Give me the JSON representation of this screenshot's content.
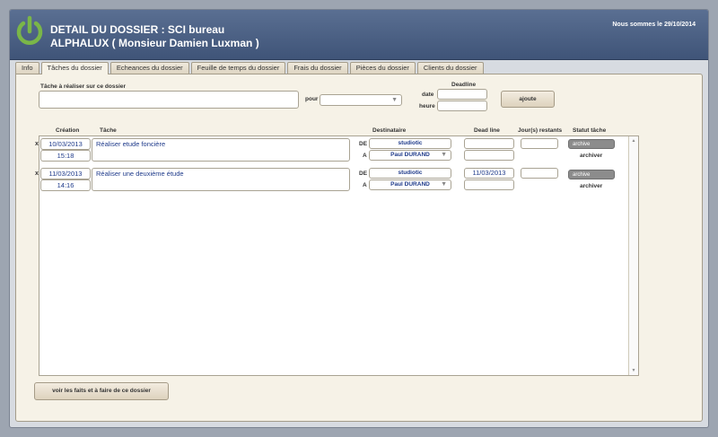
{
  "header": {
    "title_line1": "DETAIL DU DOSSIER : SCI bureau",
    "title_line2": "ALPHALUX ( Monsieur Damien Luxman )",
    "date_text": "Nous sommes le 29/10/2014"
  },
  "tabs": [
    {
      "label": "Info",
      "active": false
    },
    {
      "label": "Tâches du dossier",
      "active": true
    },
    {
      "label": "Echeances du dossier",
      "active": false
    },
    {
      "label": "Feuille de temps du dossier",
      "active": false
    },
    {
      "label": "Frais du dossier",
      "active": false
    },
    {
      "label": "Pièces du dossier",
      "active": false
    },
    {
      "label": "Clients du dossier",
      "active": false
    }
  ],
  "form": {
    "task_label": "Tâche à réaliser sur ce dossier",
    "task_value": "",
    "pour_label": "pour",
    "pour_value": "",
    "deadline_label": "Deadline",
    "date_label": "date",
    "date_value": "",
    "heure_label": "heure",
    "heure_value": "",
    "add_button": "ajoute"
  },
  "columns": {
    "creation": "Création",
    "tache": "Tâche",
    "destinataire": "Destinataire",
    "deadline": "Dead line",
    "jours": "Jour(s) restants",
    "statut": "Statut tâche"
  },
  "tasks": [
    {
      "delete": "x",
      "date": "10/03/2013",
      "time": "15:18",
      "description": "Réaliser etude foncière",
      "de_label": "DE",
      "de_value": "studiotic",
      "a_label": "A",
      "a_value": "Paul DURAND",
      "deadline": "",
      "deadline2": "",
      "jours": "",
      "status_badge": "archive",
      "status_action": "archiver"
    },
    {
      "delete": "x",
      "date": "11/03/2013",
      "time": "14:16",
      "description": "Réaliser une deuxième étude",
      "de_label": "DE",
      "de_value": "studiotic",
      "a_label": "A",
      "a_value": "Paul DURAND",
      "deadline": "11/03/2013",
      "deadline2": "",
      "jours": "",
      "status_badge": "archive",
      "status_action": "archiver"
    }
  ],
  "footer": {
    "button": "voir les faits et à faire de ce dossier"
  },
  "colors": {
    "header": "#4a5f84",
    "panel": "#f6f2e7",
    "logo_green": "#7ab648",
    "link_blue": "#1e3a8a"
  },
  "icons": {
    "logo": "power-icon",
    "dropdown": "chevron-down-icon",
    "scroll_up": "triangle-up-icon",
    "scroll_down": "triangle-down-icon"
  }
}
